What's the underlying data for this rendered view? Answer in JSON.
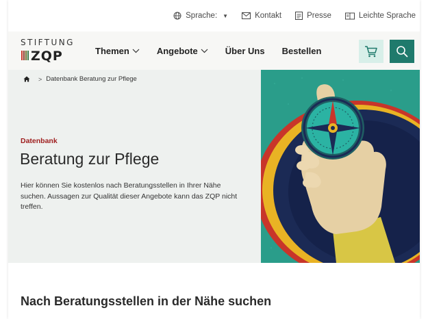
{
  "utility": {
    "language_label": "Sprache:",
    "contact_label": "Kontakt",
    "press_label": "Presse",
    "easy_language_label": "Leichte Sprache"
  },
  "logo": {
    "top": "STIFTUNG",
    "word": "ZQP"
  },
  "nav": {
    "items": [
      {
        "label": "Themen",
        "has_dropdown": true
      },
      {
        "label": "Angebote",
        "has_dropdown": true
      },
      {
        "label": "Über Uns",
        "has_dropdown": false
      },
      {
        "label": "Bestellen",
        "has_dropdown": false
      }
    ]
  },
  "breadcrumb": {
    "current": "Datenbank Beratung zur Pflege"
  },
  "hero": {
    "kicker": "Datenbank",
    "title": "Beratung zur Pflege",
    "text": "Hier können Sie kostenlos nach Beratungsstellen in Ihrer Nähe suchen. Aussagen zur Qualität dieser Angebote kann das ZQP nicht treffen."
  },
  "section": {
    "title": "Nach Beratungsstellen in der Nähe suchen"
  },
  "colors": {
    "accent": "#1f7a6c",
    "accent_light": "#d8efe9",
    "kicker_red": "#9e1d1d",
    "hero_bg": "#eef1ef",
    "art_teal": "#2a9d8a"
  },
  "icons": [
    "globe-icon",
    "mail-icon",
    "document-icon",
    "book-icon",
    "chevron-down-icon",
    "cart-icon",
    "search-icon",
    "home-icon"
  ]
}
